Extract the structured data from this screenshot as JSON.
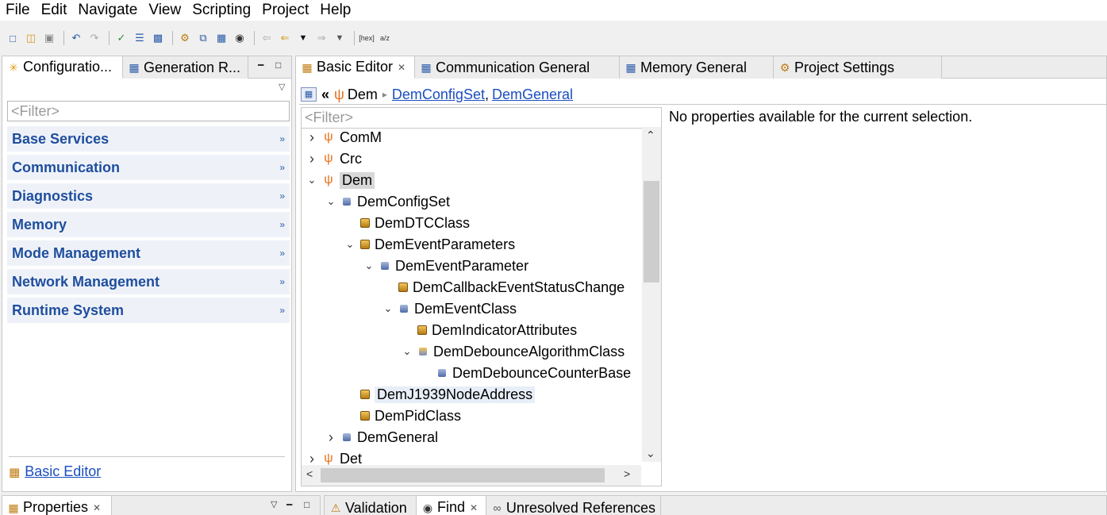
{
  "menu": [
    "File",
    "Edit",
    "Navigate",
    "View",
    "Scripting",
    "Project",
    "Help"
  ],
  "left_panel": {
    "tabs": [
      {
        "label": "Configuratio..."
      },
      {
        "label": "Generation R..."
      }
    ],
    "filter_placeholder": "<Filter>",
    "categories": [
      "Base Services",
      "Communication",
      "Diagnostics",
      "Memory",
      "Mode Management",
      "Network Management",
      "Runtime System"
    ],
    "footer_link": "Basic Editor"
  },
  "editor": {
    "tabs": [
      {
        "label": "Basic Editor",
        "active": true
      },
      {
        "label": "Communication General"
      },
      {
        "label": "Memory General"
      },
      {
        "label": "Project Settings"
      }
    ],
    "breadcrumb": {
      "root": "Dem",
      "links": [
        "DemConfigSet",
        "DemGeneral"
      ],
      "separator": ","
    },
    "tree_filter_placeholder": "<Filter>",
    "tree": [
      {
        "label": "ComM",
        "icon": "module-icon",
        "twisty": ">",
        "level": 0
      },
      {
        "label": "Crc",
        "icon": "module-icon",
        "twisty": ">",
        "level": 0
      },
      {
        "label": "Dem",
        "icon": "module-icon",
        "twisty": "v",
        "level": 0,
        "selected": true
      },
      {
        "label": "DemConfigSet",
        "icon": "container-icon",
        "twisty": "v",
        "level": 1
      },
      {
        "label": "DemDTCClass",
        "icon": "list-container-icon",
        "twisty": "",
        "level": 2
      },
      {
        "label": "DemEventParameters",
        "icon": "list-container-icon",
        "twisty": "v",
        "level": 2
      },
      {
        "label": "DemEventParameter",
        "icon": "container-icon",
        "twisty": "v",
        "level": 3
      },
      {
        "label": "DemCallbackEventStatusChange",
        "icon": "list-container-icon",
        "twisty": "",
        "level": 4
      },
      {
        "label": "DemEventClass",
        "icon": "container-icon",
        "twisty": "v",
        "level": 4
      },
      {
        "label": "DemIndicatorAttributes",
        "icon": "list-container-icon",
        "twisty": "",
        "level": 5
      },
      {
        "label": "DemDebounceAlgorithmClass",
        "icon": "choice-container-icon",
        "twisty": "v",
        "level": 5
      },
      {
        "label": "DemDebounceCounterBase",
        "icon": "container-icon",
        "twisty": "",
        "level": 6
      },
      {
        "label": "DemJ1939NodeAddress",
        "icon": "list-container-icon",
        "twisty": "",
        "level": 2,
        "hover": true
      },
      {
        "label": "DemPidClass",
        "icon": "list-container-icon",
        "twisty": "",
        "level": 2
      },
      {
        "label": "DemGeneral",
        "icon": "container-icon",
        "twisty": ">",
        "level": 1
      },
      {
        "label": "Det",
        "icon": "module-icon",
        "twisty": ">",
        "level": 0
      }
    ],
    "properties_message": "No properties available for the current selection."
  },
  "bottom": {
    "left_tabs": [
      {
        "label": "Properties"
      }
    ],
    "right_tabs": [
      {
        "label": "Validation"
      },
      {
        "label": "Find"
      },
      {
        "label": "Unresolved References"
      }
    ]
  },
  "colors": {
    "category_text": "#1f4e9e",
    "category_bg": "#eef2f8",
    "link": "#1a4ec0",
    "module_icon": "#e8701a"
  }
}
